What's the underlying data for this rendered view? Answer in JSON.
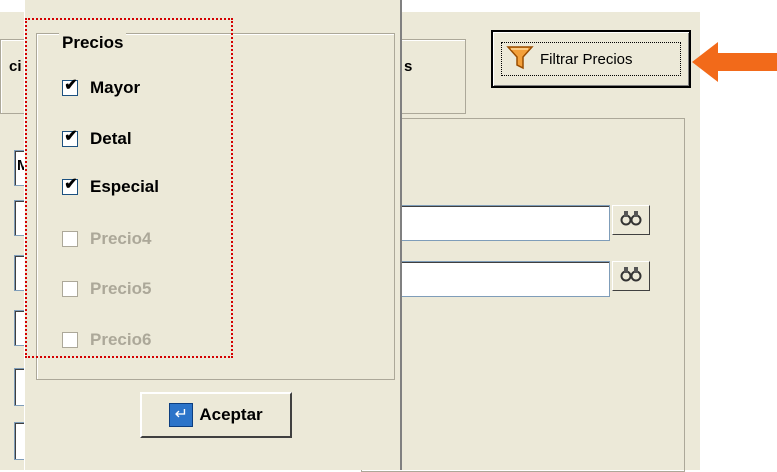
{
  "background_form": {
    "left_fragment": "ci",
    "right_fragment": "s",
    "side_fragment": "M"
  },
  "filter_button": {
    "label": "Filtrar Precios",
    "icon": "funnel-icon"
  },
  "arrow": {
    "color": "#f26a1a"
  },
  "prices_popup": {
    "title": "Precios",
    "options": [
      {
        "label": "Mayor",
        "checked": true,
        "enabled": true
      },
      {
        "label": "Detal",
        "checked": true,
        "enabled": true
      },
      {
        "label": "Especial",
        "checked": true,
        "enabled": true
      },
      {
        "label": "Precio4",
        "checked": false,
        "enabled": false
      },
      {
        "label": "Precio5",
        "checked": false,
        "enabled": false
      },
      {
        "label": "Precio6",
        "checked": false,
        "enabled": false
      }
    ],
    "accept_label": "Aceptar",
    "accept_icon": "enter-icon"
  }
}
